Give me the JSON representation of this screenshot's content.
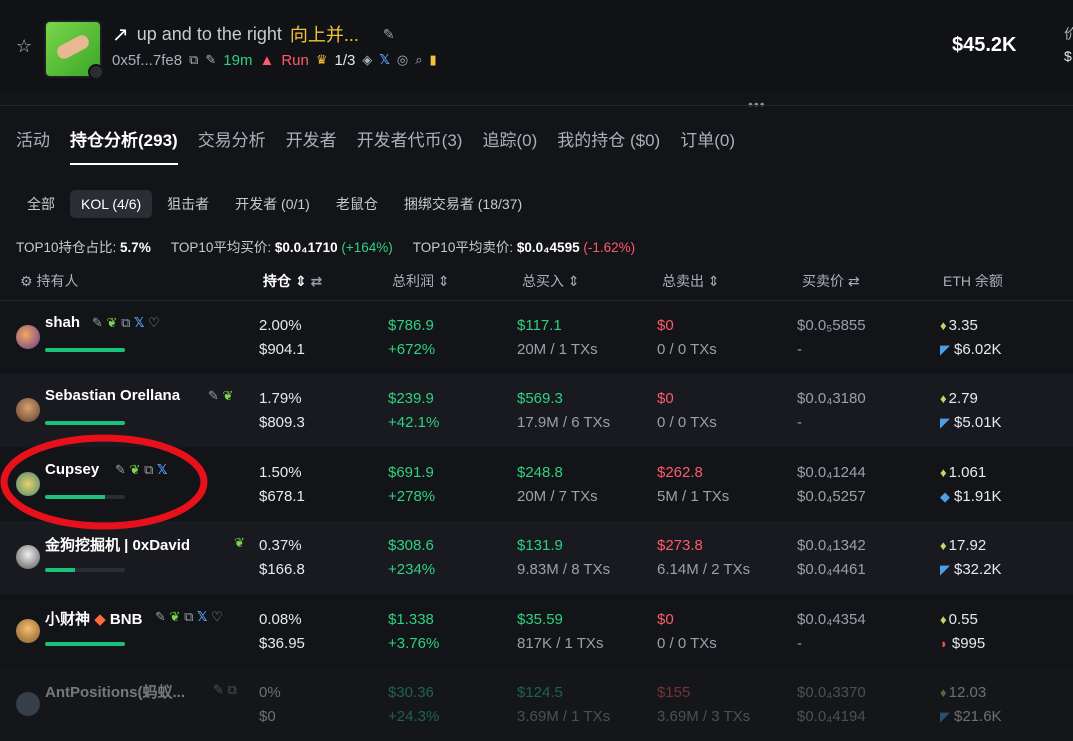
{
  "header": {
    "title_arrow": "↗",
    "title_name": "up and to the right",
    "title_cn": "向上并...",
    "address": "0x5f...7fe8",
    "age": "19m",
    "run_label": "Run",
    "crown_count": "1/3",
    "market_cap": "$45.2K",
    "edge_top": "价",
    "edge_bottom": "$"
  },
  "tabs": [
    {
      "label": "活动"
    },
    {
      "label": "持仓分析(293)"
    },
    {
      "label": "交易分析"
    },
    {
      "label": "开发者"
    },
    {
      "label": "开发者代币(3)"
    },
    {
      "label": "追踪(0)"
    },
    {
      "label": "我的持仓 ($0)"
    },
    {
      "label": "订单(0)"
    }
  ],
  "filters": [
    {
      "label": "全部"
    },
    {
      "label": "KOL (4/6)"
    },
    {
      "label": "狙击者"
    },
    {
      "label": "开发者 (0/1)"
    },
    {
      "label": "老鼠仓"
    },
    {
      "label": "捆绑交易者 (18/37)"
    }
  ],
  "stats": {
    "top10_share_label": "TOP10持仓占比:",
    "top10_share_value": "5.7%",
    "top10_buy_label": "TOP10平均买价:",
    "top10_buy_value": "$0.0₄1710",
    "top10_buy_change": "(+164%)",
    "top10_sell_label": "TOP10平均卖价:",
    "top10_sell_value": "$0.0₄4595",
    "top10_sell_change": "(-1.62%)"
  },
  "columns": {
    "holder": "持有人",
    "position": "持仓",
    "total_profit": "总利润",
    "total_buy": "总买入",
    "total_sell": "总卖出",
    "price": "买卖价",
    "eth_balance": "ETH 余额"
  },
  "rows": [
    {
      "name": "shah",
      "holding_pct": "2.00%",
      "holding_usd": "$904.1",
      "profit": "$786.9",
      "profit_pct": "+672%",
      "buy": "$117.1",
      "buy_detail": "20M / 1 TXs",
      "sell": "$0",
      "sell_detail": "0 / 0 TXs",
      "buy_price": "$0.0₅5855",
      "sell_price": "-",
      "eth": "3.35",
      "eth_usd": "$6.02K",
      "bar": 1.0
    },
    {
      "name": "Sebastian Orellana",
      "holding_pct": "1.79%",
      "holding_usd": "$809.3",
      "profit": "$239.9",
      "profit_pct": "+42.1%",
      "buy": "$569.3",
      "buy_detail": "17.9M / 6 TXs",
      "sell": "$0",
      "sell_detail": "0 / 0 TXs",
      "buy_price": "$0.0₄3180",
      "sell_price": "-",
      "eth": "2.79",
      "eth_usd": "$5.01K",
      "bar": 1.0
    },
    {
      "name": "Cupsey",
      "holding_pct": "1.50%",
      "holding_usd": "$678.1",
      "profit": "$691.9",
      "profit_pct": "+278%",
      "buy": "$248.8",
      "buy_detail": "20M / 7 TXs",
      "sell": "$262.8",
      "sell_detail": "5M / 1 TXs",
      "buy_price": "$0.0₄1244",
      "sell_price": "$0.0₄5257",
      "eth": "1.061",
      "eth_usd": "$1.91K",
      "bar": 0.75
    },
    {
      "name": "金狗挖掘机 | 0xDavid",
      "holding_pct": "0.37%",
      "holding_usd": "$166.8",
      "profit": "$308.6",
      "profit_pct": "+234%",
      "buy": "$131.9",
      "buy_detail": "9.83M / 8 TXs",
      "sell": "$273.8",
      "sell_detail": "6.14M / 2 TXs",
      "buy_price": "$0.0₄1342",
      "sell_price": "$0.0₄4461",
      "eth": "17.92",
      "eth_usd": "$32.2K",
      "bar": 0.38
    },
    {
      "name": "小财神",
      "name_suffix": "BNB",
      "holding_pct": "0.08%",
      "holding_usd": "$36.95",
      "profit": "$1.338",
      "profit_pct": "+3.76%",
      "buy": "$35.59",
      "buy_detail": "817K / 1 TXs",
      "sell": "$0",
      "sell_detail": "0 / 0 TXs",
      "buy_price": "$0.0₄4354",
      "sell_price": "-",
      "eth": "0.55",
      "eth_usd": "$995",
      "bar": 1.0
    },
    {
      "name": "AntPositions(蚂蚁...",
      "holding_pct": "0%",
      "holding_usd": "$0",
      "profit": "$30.36",
      "profit_pct": "+24.3%",
      "buy": "$124.5",
      "buy_detail": "3.69M / 1 TXs",
      "sell": "$155",
      "sell_detail": "3.69M / 3 TXs",
      "buy_price": "$0.0₄3370",
      "sell_price": "$0.0₄4194",
      "eth": "12.03",
      "eth_usd": "$21.6K",
      "bar": 0
    }
  ]
}
